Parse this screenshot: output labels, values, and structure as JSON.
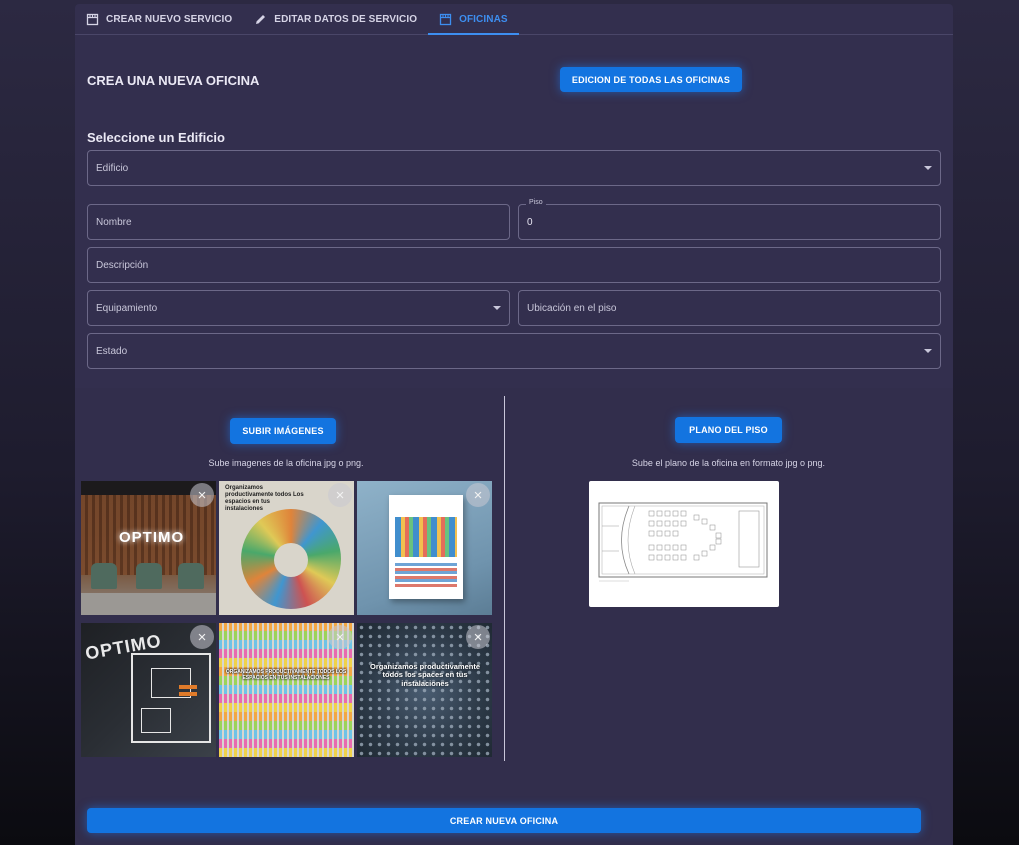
{
  "tabs": [
    {
      "label": "CREAR NUEVO SERVICIO",
      "icon": "storefront-icon"
    },
    {
      "label": "EDITAR DATOS DE SERVICIO",
      "icon": "pencil-icon"
    },
    {
      "label": "OFICINAS",
      "icon": "storefront-icon",
      "active": true
    }
  ],
  "header": {
    "title": "CREA UNA NUEVA OFICINA",
    "edit_all_button": "EDICION DE TODAS LAS OFICINAS"
  },
  "form": {
    "building_heading": "Seleccione un Edificio",
    "building_placeholder": "Edificio",
    "name_placeholder": "Nombre",
    "floor_label": "Piso",
    "floor_value": "0",
    "description_placeholder": "Descripción",
    "equipment_placeholder": "Equipamiento",
    "location_placeholder": "Ubicación en el piso",
    "status_placeholder": "Estado"
  },
  "images": {
    "upload_button": "SUBIR IMÁGENES",
    "hint": "Sube imagenes de la oficina jpg o png.",
    "thumb_1_text": "OPTIMO",
    "thumb_2_text": "Organizamos productivamente todos Los espacios en tus instalaciones",
    "thumb_4_text": "OPTIMO",
    "thumb_5_text": "ORGANIZAMOS PRODUCTIVAMENTE TODOS LOS ESPACIOS EN TUS INSTALACIONES",
    "thumb_6_text": "Organizamos productivamente todos los spaces en tus instalaciones"
  },
  "floorplan": {
    "upload_button": "PLANO DEL PISO",
    "hint": "Sube el plano de la oficina en formato jpg o png."
  },
  "submit_button": "CREAR NUEVA OFICINA",
  "colors": {
    "accent": "#1374e0",
    "panel": "#332f4e",
    "active_tab": "#3d8ef0"
  }
}
